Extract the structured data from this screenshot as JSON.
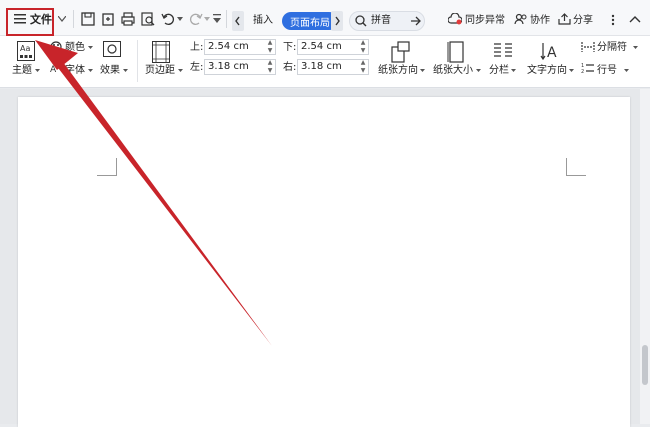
{
  "menu": {
    "file_label": "文件"
  },
  "tabs": {
    "insert": "插入",
    "page_layout": "页面布局",
    "pinyin": "拼音"
  },
  "top_right": {
    "sync": "同步异常",
    "collab": "协作",
    "share": "分享"
  },
  "ribbon": {
    "theme": "主题",
    "color": "颜色",
    "font": "字体",
    "effect": "效果",
    "margins": "页边距",
    "orientation": "纸张方向",
    "paper_size": "纸张大小",
    "columns": "分栏",
    "text_direction": "文字方向",
    "separator": "分隔符",
    "line_number": "行号",
    "top_label": "上:",
    "bottom_label": "下:",
    "left_label": "左:",
    "right_label": "右:",
    "top_value": "2.54 cm",
    "bottom_value": "2.54 cm",
    "left_value": "3.18 cm",
    "right_value": "3.18 cm"
  },
  "colors": {
    "accent": "#2f6fe0",
    "annotation": "#c8242a"
  }
}
